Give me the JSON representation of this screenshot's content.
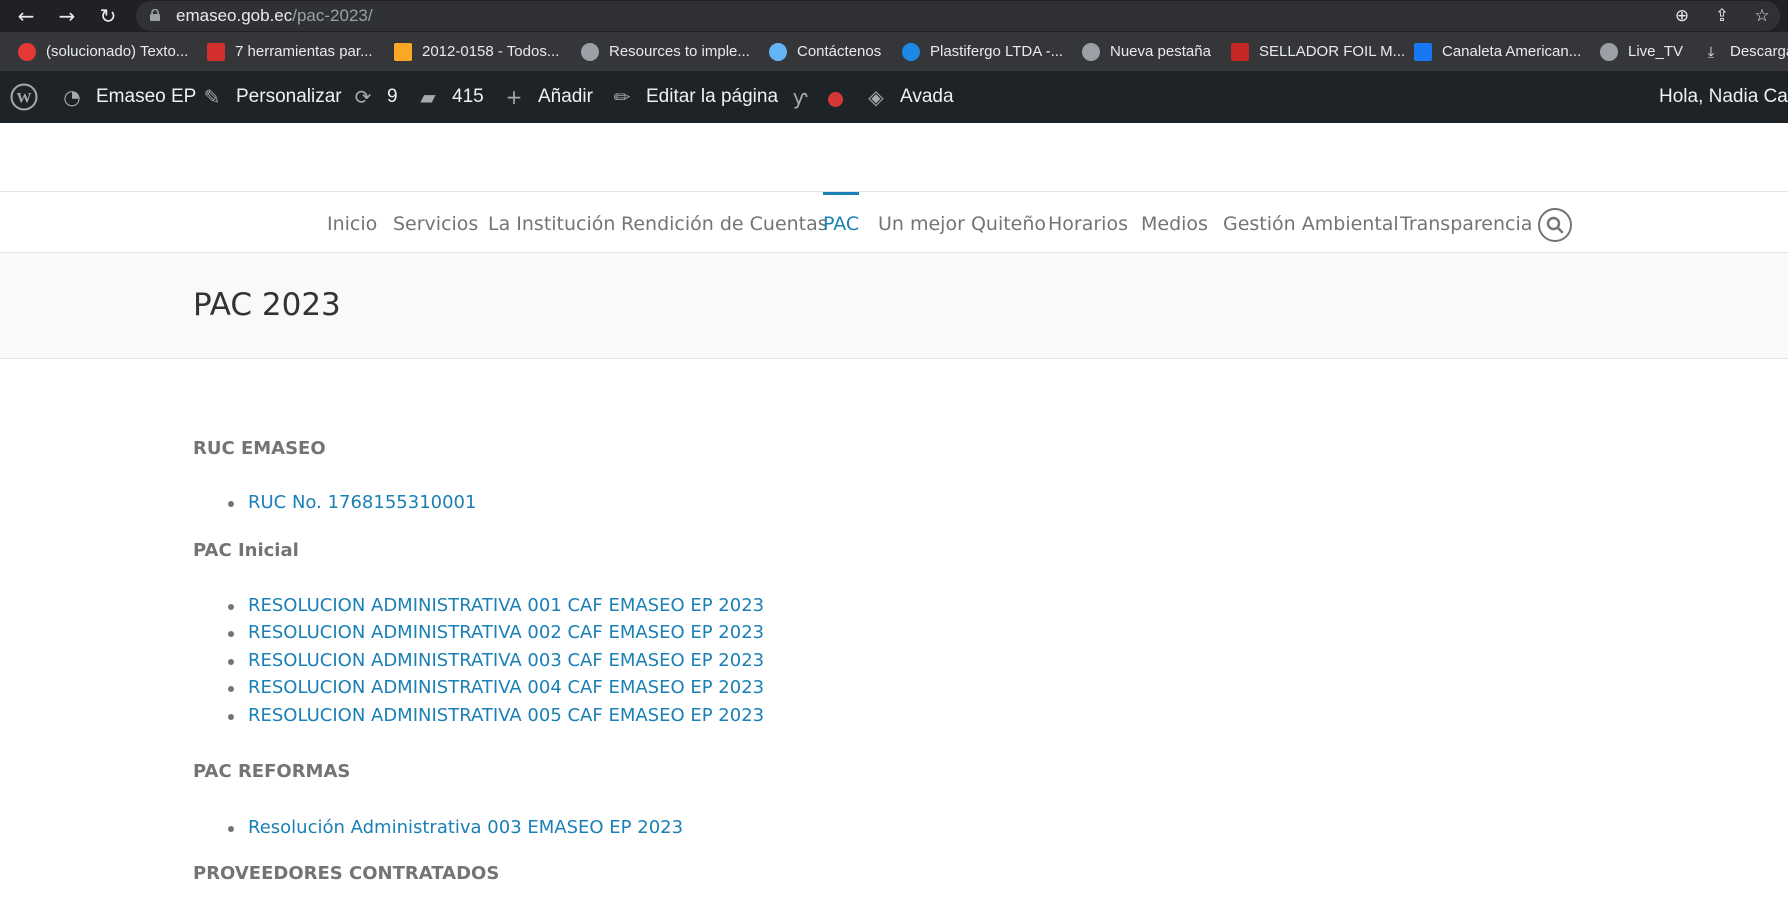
{
  "browser": {
    "url_host": "emaseo.gob.ec",
    "url_path": "/pac-2023/",
    "bookmarks": [
      {
        "label": "(solucionado) Texto...",
        "icon": "page-icon",
        "color": "#e53935"
      },
      {
        "label": "7 herramientas par...",
        "icon": "ch-logo-icon",
        "color": "#d32f2f"
      },
      {
        "label": "2012-0158 - Todos...",
        "icon": "doc-icon",
        "color": "#f9a825"
      },
      {
        "label": "Resources to imple...",
        "icon": "globe-icon",
        "color": "#9aa0a6"
      },
      {
        "label": "Contáctenos",
        "icon": "site-icon",
        "color": "#64b5f6"
      },
      {
        "label": "Plastifergo LTDA -...",
        "icon": "eye-icon",
        "color": "#1e88e5"
      },
      {
        "label": "Nueva pestaña",
        "icon": "globe-icon",
        "color": "#9aa0a6"
      },
      {
        "label": "SELLADOR FOIL M...",
        "icon": "image-icon",
        "color": "#c62828"
      },
      {
        "label": "Canaleta American...",
        "icon": "facebook-icon",
        "color": "#1877f2"
      },
      {
        "label": "Live_TV",
        "icon": "globe-icon",
        "color": "#9aa0a6"
      },
      {
        "label": "Descarga",
        "icon": "download-icon",
        "color": "#e8eaed"
      }
    ]
  },
  "wp_admin": {
    "site_name": "Emaseo EP",
    "customize": "Personalizar",
    "updates_count": "9",
    "comments_count": "415",
    "add_new": "Añadir",
    "edit_page": "Editar la página",
    "avada": "Avada",
    "greeting": "Hola, Nadia Carr"
  },
  "site_menu": {
    "items": [
      "Inicio",
      "Servicios",
      "La Institución",
      "Rendición de Cuentas",
      "PAC",
      "Un mejor Quiteño",
      "Horarios",
      "Medios",
      "Gestión Ambiental",
      "Transparencia"
    ],
    "active": "PAC"
  },
  "page": {
    "title": "PAC 2023"
  },
  "content": {
    "ruc_heading": "RUC EMASEO",
    "ruc_link": "RUC No. 1768155310001",
    "pac_inicial_heading": "PAC Inicial",
    "pac_inicial_links": [
      "RESOLUCION ADMINISTRATIVA 001 CAF EMASEO EP 2023",
      "RESOLUCION ADMINISTRATIVA 002 CAF EMASEO EP 2023",
      "RESOLUCION ADMINISTRATIVA 003 CAF EMASEO EP 2023",
      "RESOLUCION ADMINISTRATIVA 004 CAF EMASEO EP 2023",
      "RESOLUCION ADMINISTRATIVA 005 CAF EMASEO EP 2023"
    ],
    "pac_reformas_heading": "PAC REFORMAS",
    "pac_reformas_links": [
      "Resolución Administrativa 003 EMASEO EP 2023"
    ],
    "proveedores_heading": "PROVEEDORES CONTRATADOS"
  },
  "colors": {
    "link": "#1a80b6",
    "admin_bar": "#1d2327",
    "browser_bar": "#202124"
  }
}
